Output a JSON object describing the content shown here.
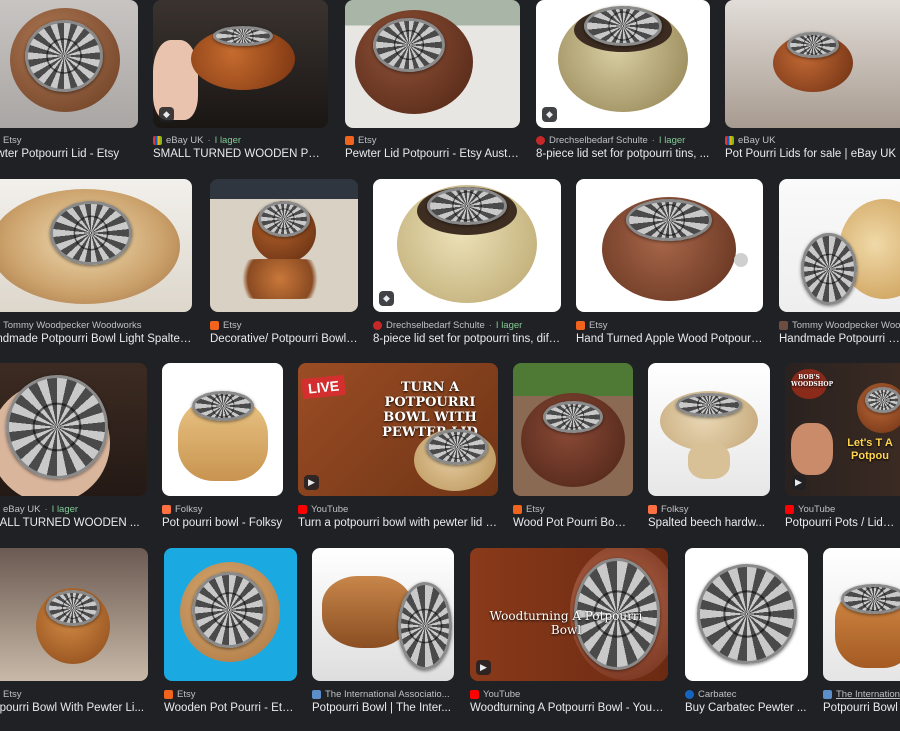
{
  "colors": {
    "background": "#202124",
    "text": "#e8eaed",
    "source_text": "#bdc1c6",
    "in_stock": "#81c995"
  },
  "rows": [
    {
      "tiles": [
        {
          "source": "Etsy",
          "title": "ewter Potpourri Lid - Etsy",
          "fav": "etsy",
          "in_stock": "",
          "badge": false
        },
        {
          "source": "eBay UK",
          "title": "SMALL TURNED WOODEN POT...",
          "fav": "ebay",
          "in_stock": "I lager",
          "badge": true
        },
        {
          "source": "Etsy",
          "title": "Pewter Lid Potpourri - Etsy Austr...",
          "fav": "etsy",
          "in_stock": "",
          "badge": false
        },
        {
          "source": "Drechselbedarf Schulte",
          "title": "8-piece lid set for potpourri tins, ...",
          "fav": "drechsel",
          "in_stock": "I lager",
          "badge": true
        },
        {
          "source": "eBay UK",
          "title": "Pot Pourri Lids for sale | eBay UK",
          "fav": "ebay",
          "in_stock": "",
          "badge": false
        }
      ]
    },
    {
      "tiles": [
        {
          "source": "Tommy Woodpecker Woodworks",
          "title": "andmade Potpourri Bowl Light Spalted...",
          "fav": "tommy",
          "in_stock": "",
          "badge": false
        },
        {
          "source": "Etsy",
          "title": "Decorative/ Potpourri Bowl ...",
          "fav": "etsy",
          "in_stock": "",
          "badge": false
        },
        {
          "source": "Drechselbedarf Schulte",
          "title": "8-piece lid set for potpourri tins, diff...",
          "fav": "drechsel",
          "in_stock": "I lager",
          "badge": true
        },
        {
          "source": "Etsy",
          "title": "Hand Turned Apple Wood Potpourri...",
          "fav": "etsy",
          "in_stock": "",
          "badge": false
        },
        {
          "source": "Tommy Woodpecker Woo",
          "title": "Handmade Potpourri Bow",
          "fav": "tommy",
          "in_stock": "",
          "badge": false
        }
      ]
    },
    {
      "tiles": [
        {
          "source": "eBay UK",
          "title": "MALL TURNED WOODEN ...",
          "fav": "ebay",
          "in_stock": "I lager",
          "badge": false
        },
        {
          "source": "Folksy",
          "title": "Pot pourri bowl - Folksy",
          "fav": "folksy",
          "in_stock": "",
          "badge": false
        },
        {
          "source": "YouTube",
          "title": "Turn a potpourri bowl with pewter lid - ...",
          "fav": "youtube",
          "in_stock": "",
          "badge": true,
          "overlay": "TURN A POTPOURRI BOWL WITH PEWTER LID",
          "live": "LIVE"
        },
        {
          "source": "Etsy",
          "title": "Wood Pot Pourri Bowl...",
          "fav": "etsy",
          "in_stock": "",
          "badge": false
        },
        {
          "source": "Folksy",
          "title": "Spalted beech hardw...",
          "fav": "folksy",
          "in_stock": "",
          "badge": false
        },
        {
          "source": "YouTube",
          "title": "Potpourri Pots / Lids Fro",
          "fav": "youtube",
          "in_stock": "",
          "badge": true,
          "overlay": "Let's T A Potpou",
          "logo": "BOB'S WOODSHOP"
        }
      ]
    },
    {
      "tiles": [
        {
          "source": "Etsy",
          "title": "otpourri Bowl With Pewter Li...",
          "fav": "etsy",
          "in_stock": "",
          "badge": false
        },
        {
          "source": "Etsy",
          "title": "Wooden Pot Pourri - Ets...",
          "fav": "etsy",
          "in_stock": "",
          "badge": false
        },
        {
          "source": "The International Associatio...",
          "title": "Potpourri Bowl | The Inter...",
          "fav": "iaw",
          "in_stock": "",
          "badge": false
        },
        {
          "source": "YouTube",
          "title": "Woodturning A Potpourri Bowl - YouTube",
          "fav": "youtube",
          "in_stock": "",
          "badge": true,
          "overlay": "Woodturning A Potpourri Bowl"
        },
        {
          "source": "Carbatec",
          "title": "Buy Carbatec Pewter ...",
          "fav": "carbatec",
          "in_stock": "",
          "badge": false
        },
        {
          "source": "The Internation",
          "title": "Potpourri Bowl",
          "fav": "iaw",
          "in_stock": "",
          "badge": false
        }
      ]
    }
  ],
  "icons": {
    "shopping_badge": "tag-icon",
    "video_badge": "play-icon"
  }
}
